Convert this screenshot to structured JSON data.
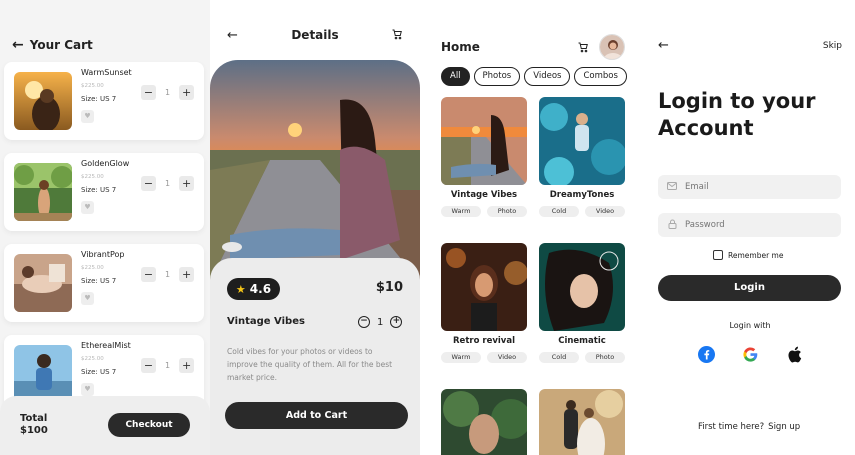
{
  "cart": {
    "title": "Your Cart",
    "items": [
      {
        "name": "WarmSunset",
        "price": "$225.00",
        "size": "Size: US 7",
        "qty": "1"
      },
      {
        "name": "GoldenGlow",
        "price": "$225.00",
        "size": "Size: US 7",
        "qty": "1"
      },
      {
        "name": "VibrantPop",
        "price": "$225.00",
        "size": "Size: US 7",
        "qty": "1"
      },
      {
        "name": "EtherealMist",
        "price": "$225.00",
        "size": "Size: US 7",
        "qty": "1"
      }
    ],
    "minus": "−",
    "plus": "+",
    "total_label": "Total",
    "total_value": "$100",
    "checkout_label": "Checkout"
  },
  "details": {
    "title": "Details",
    "rating": "4.6",
    "price": "$10",
    "name": "Vintage Vibes",
    "qty": "1",
    "description": "Cold vibes for your photos or videos to improve the quality of them. All for the best market price.",
    "add_to_cart_label": "Add to Cart"
  },
  "home": {
    "title": "Home",
    "filters": [
      "All",
      "Photos",
      "Videos",
      "Combos"
    ],
    "active_filter": "All",
    "products": [
      {
        "title": "Vintage Vibes",
        "tags": [
          "Warm",
          "Photo"
        ]
      },
      {
        "title": "DreamyTones",
        "tags": [
          "Cold",
          "Video"
        ]
      },
      {
        "title": "Retro revival",
        "tags": [
          "Warm",
          "Video"
        ]
      },
      {
        "title": "Cinematic",
        "tags": [
          "Cold",
          "Photo"
        ]
      }
    ]
  },
  "login": {
    "skip_label": "Skip",
    "heading": "Login to your Account",
    "email_placeholder": "Email",
    "password_placeholder": "Password",
    "remember_label": "Remember me",
    "login_label": "Login",
    "login_with_label": "Login with",
    "signup_prompt": "First time here?",
    "signup_link": "Sign up"
  },
  "icons": {
    "back": "arrow-left-icon",
    "cart": "cart-icon",
    "heart": "heart-icon",
    "star": "star-icon",
    "email": "mail-icon",
    "password": "lock-icon",
    "facebook": "facebook-icon",
    "google": "google-icon",
    "apple": "apple-icon"
  },
  "colors": {
    "primary_dark": "#2a2a2a",
    "panel_grey": "#ececec",
    "star_yellow": "#f5c518",
    "facebook_blue": "#1877f2"
  }
}
